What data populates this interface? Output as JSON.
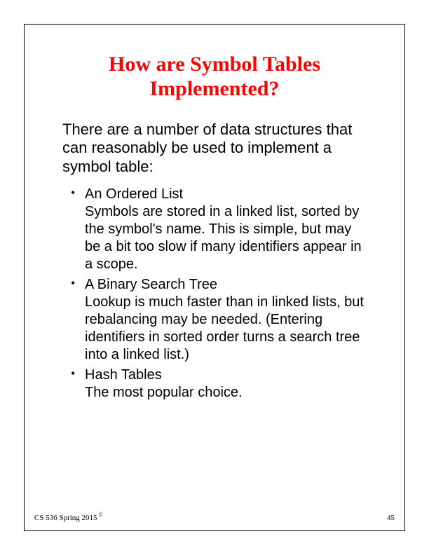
{
  "title": "How are Symbol Tables Implemented?",
  "intro": "There are a number of data structures that can reasonably be used to implement a symbol table:",
  "bullets": [
    {
      "title": "An Ordered List",
      "desc": "Symbols are stored in a linked list, sorted by the symbol's name. This is simple, but may be a bit too slow if many identifiers appear in a scope."
    },
    {
      "title": "A Binary Search Tree",
      "desc": "Lookup is much faster than in linked lists, but rebalancing may be needed. (Entering identifiers in sorted order turns a search tree into a linked list.)"
    },
    {
      "title": "Hash Tables",
      "desc": "The most popular choice."
    }
  ],
  "footer": {
    "course": "CS 536  Spring 2015",
    "copyright": "©",
    "page": "45"
  }
}
